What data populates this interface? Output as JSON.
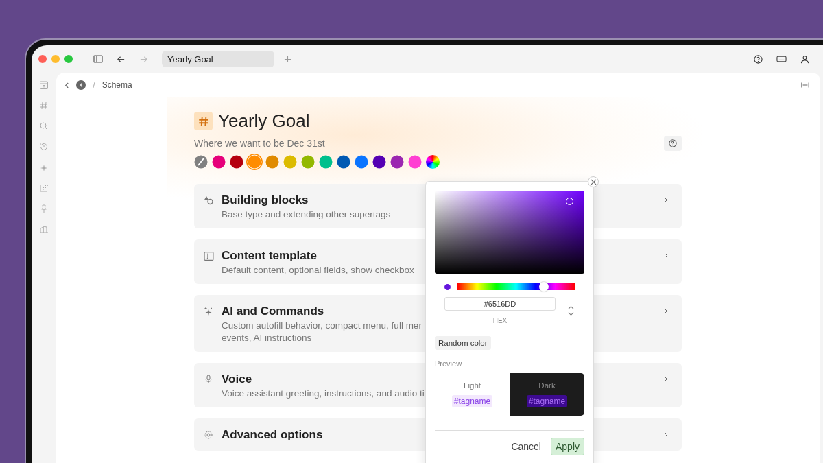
{
  "window": {
    "tabs": [
      {
        "label": "Yearly Goal",
        "selected": true
      }
    ]
  },
  "breadcrumb": {
    "current": "Schema",
    "separator": "/"
  },
  "header": {
    "title": "Yearly Goal",
    "subtitle": "Where we want to be Dec 31st"
  },
  "swatches": [
    {
      "kind": "none",
      "selected": false
    },
    {
      "kind": "solid",
      "color": "#e6007a",
      "selected": false
    },
    {
      "kind": "solid",
      "color": "#b5000f",
      "selected": false
    },
    {
      "kind": "solid",
      "color": "#ff8c00",
      "selected": true
    },
    {
      "kind": "solid",
      "color": "#e08a00",
      "selected": false
    },
    {
      "kind": "solid",
      "color": "#dcbb00",
      "selected": false
    },
    {
      "kind": "solid",
      "color": "#93b800",
      "selected": false
    },
    {
      "kind": "solid",
      "color": "#00c08c",
      "selected": false
    },
    {
      "kind": "solid",
      "color": "#0059b3",
      "selected": false
    },
    {
      "kind": "solid",
      "color": "#0a74ff",
      "selected": false
    },
    {
      "kind": "solid",
      "color": "#5500b3",
      "selected": false
    },
    {
      "kind": "solid",
      "color": "#9b27b0",
      "selected": false
    },
    {
      "kind": "solid",
      "color": "#ff3fd2",
      "selected": false
    },
    {
      "kind": "custom",
      "selected": false
    }
  ],
  "sections": [
    {
      "kind": "blocks",
      "title": "Building blocks",
      "description": "Base type and extending other supertags"
    },
    {
      "kind": "template",
      "title": "Content template",
      "description": "Default content, optional fields, show checkbox"
    },
    {
      "kind": "ai",
      "title": "AI and Commands",
      "description": "Custom autofill behavior, compact menu, full mer",
      "description_2": "events, AI instructions"
    },
    {
      "kind": "voice",
      "title": "Voice",
      "description": "Voice assistant greeting, instructions, and audio ti"
    },
    {
      "kind": "advanced",
      "title": "Advanced options"
    }
  ],
  "color_picker": {
    "hue": {
      "level": 0.735
    },
    "hex": "#6516DD",
    "format": "HEX",
    "random_button": "Random color",
    "preview_label": "Preview",
    "light_label": "Light",
    "dark_label": "Dark",
    "light_tag": "#tagname",
    "dark_tag": "#tagname",
    "cancel": "Cancel",
    "apply": "Apply"
  }
}
